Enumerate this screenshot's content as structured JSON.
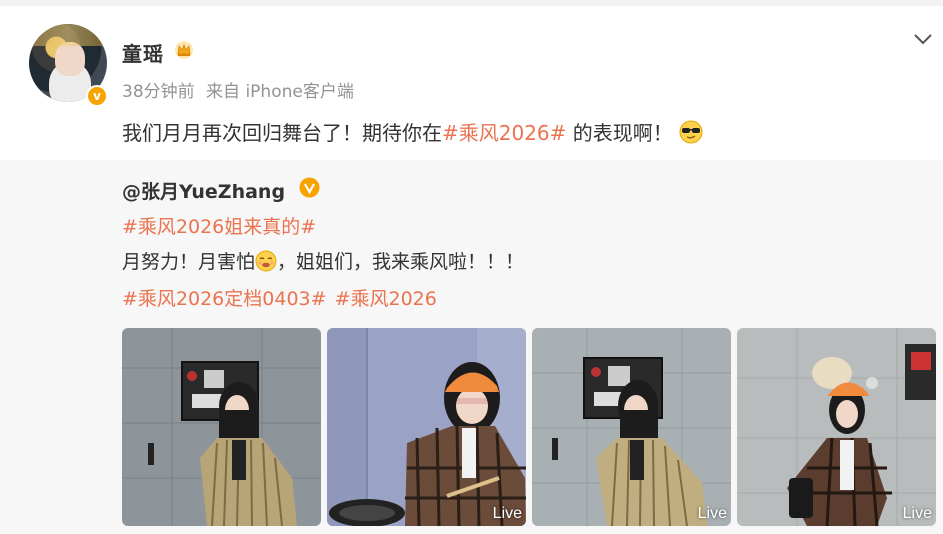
{
  "post": {
    "username": "童瑶",
    "time": "38分钟前",
    "source": "来自 iPhone客户端",
    "text_before": "我们月月再次回归舞台了！期待你在",
    "topic": "#乘风2026#",
    "text_after": " 的表现啊！"
  },
  "repost": {
    "user": "@张月YueZhang",
    "topic_line": "#乘风2026姐来真的#",
    "text_before": "月努力！月害怕",
    "text_after": "，姐姐们，我来乘风啦！！！",
    "topics": [
      "#乘风2026定档0403#",
      "#乘风2026"
    ],
    "images": [
      {
        "live": ""
      },
      {
        "live": "Live"
      },
      {
        "live": "Live"
      },
      {
        "live": "Live"
      }
    ]
  },
  "colors": {
    "topic": "#eb7350",
    "repost_bg": "#f7f7f7",
    "badge": "#f7a400"
  },
  "icons": [
    "crown-icon",
    "chevron-down-icon",
    "sunglasses-emoji-icon",
    "verified-badge-icon",
    "nervous-emoji-icon"
  ]
}
